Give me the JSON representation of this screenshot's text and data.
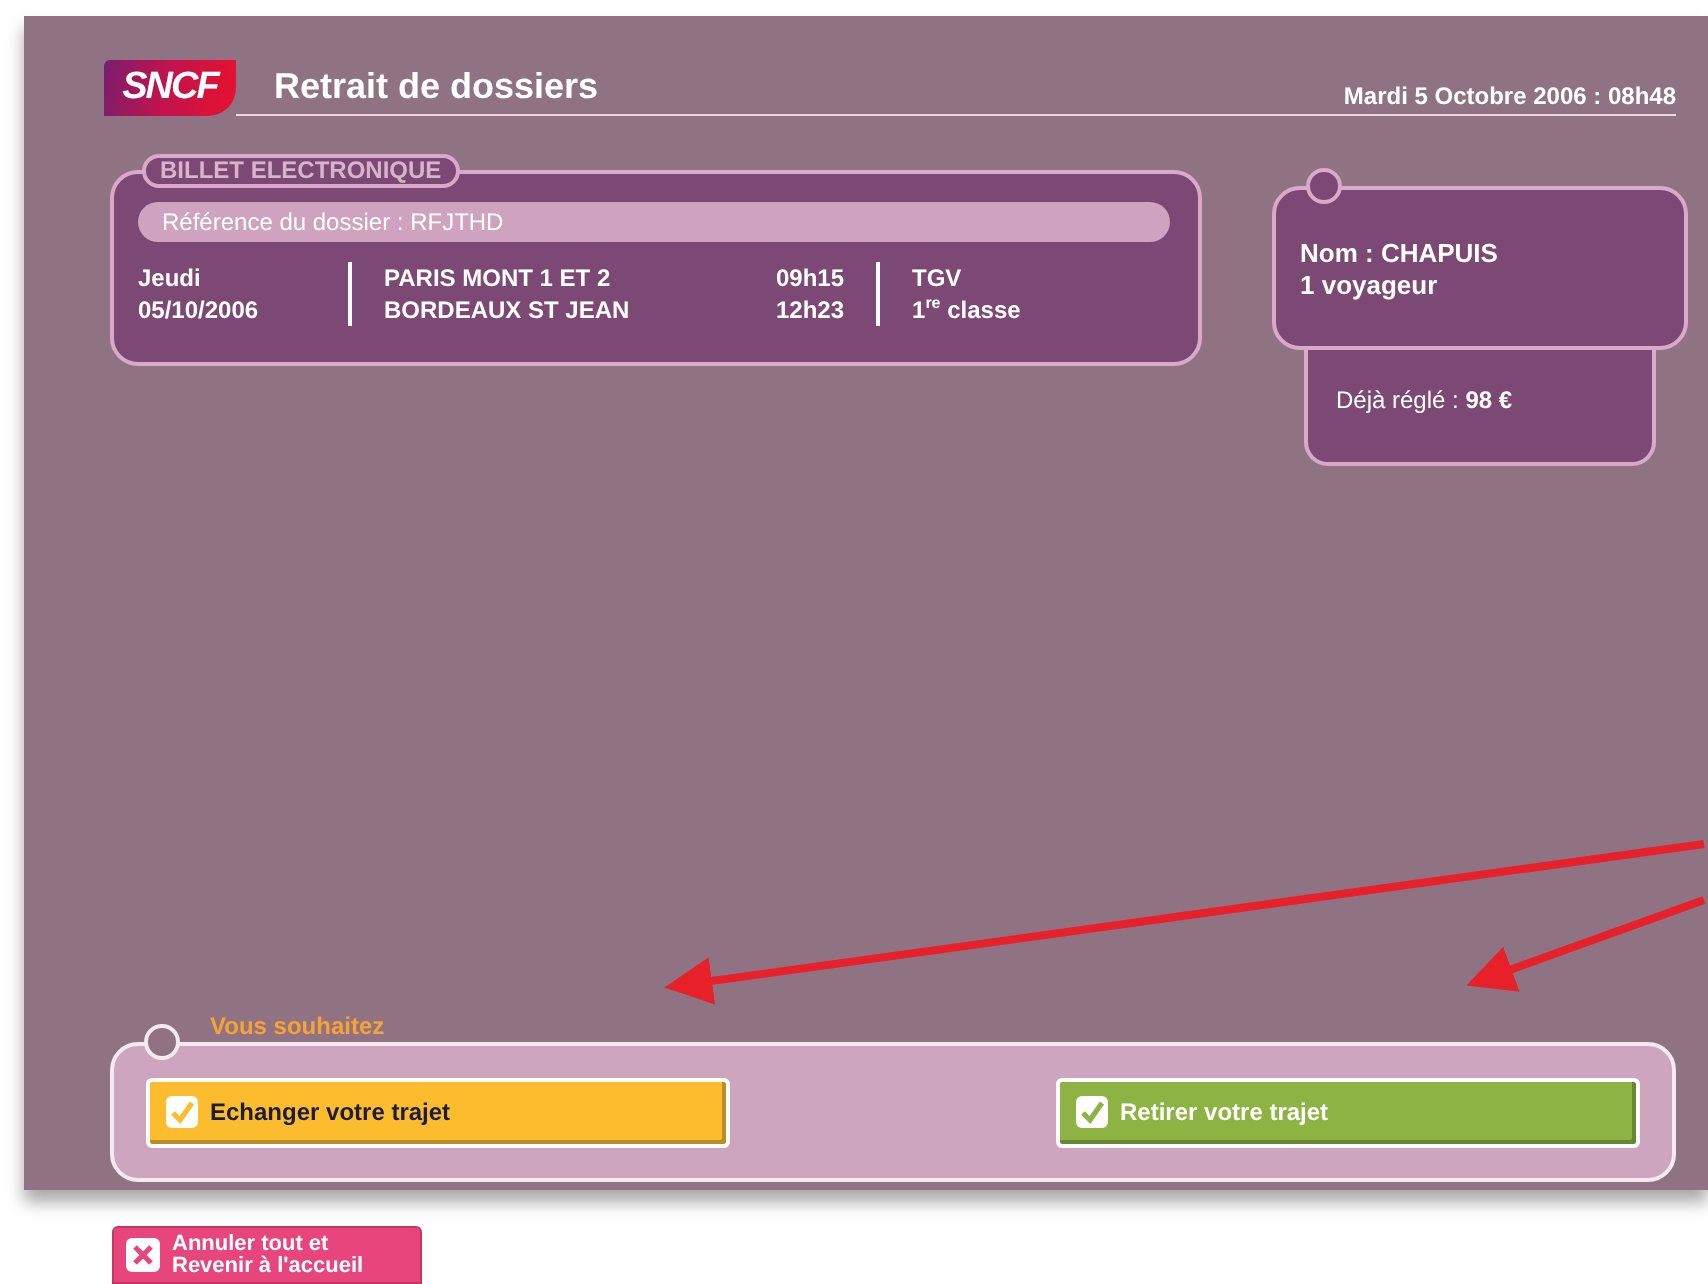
{
  "header": {
    "logo": "SNCF",
    "title": "Retrait de dossiers",
    "date": "Mardi 5 Octobre 2006 : 08h48"
  },
  "ticket": {
    "legend": "BILLET ELECTRONIQUE",
    "reference": "Référence du dossier : RFJTHD",
    "day": "Jeudi",
    "date": "05/10/2006",
    "departure": "PARIS MONT 1 ET 2",
    "arrival": "BORDEAUX ST JEAN",
    "departure_time": "09h15",
    "arrival_time": "12h23",
    "train": "TGV",
    "class": "1$^{re}$ classe"
  },
  "traveler": {
    "name": "Nom : CHAPUIS",
    "count": "1 voyageur",
    "paid": "Déjà réglé : **98 €**"
  },
  "choices": {
    "label": "Vous souhaitez",
    "options": [
      {
        "label": "Echanger votre trajet",
        "checked": true,
        "color": "#fbbd2e"
      },
      {
        "label": "Retirer votre trajet",
        "checked": true,
        "color": "#8db443"
      }
    ]
  },
  "cancel": {
    "lines": [
      "Annuler tout et",
      "Revenir à l'accueil"
    ]
  }
}
